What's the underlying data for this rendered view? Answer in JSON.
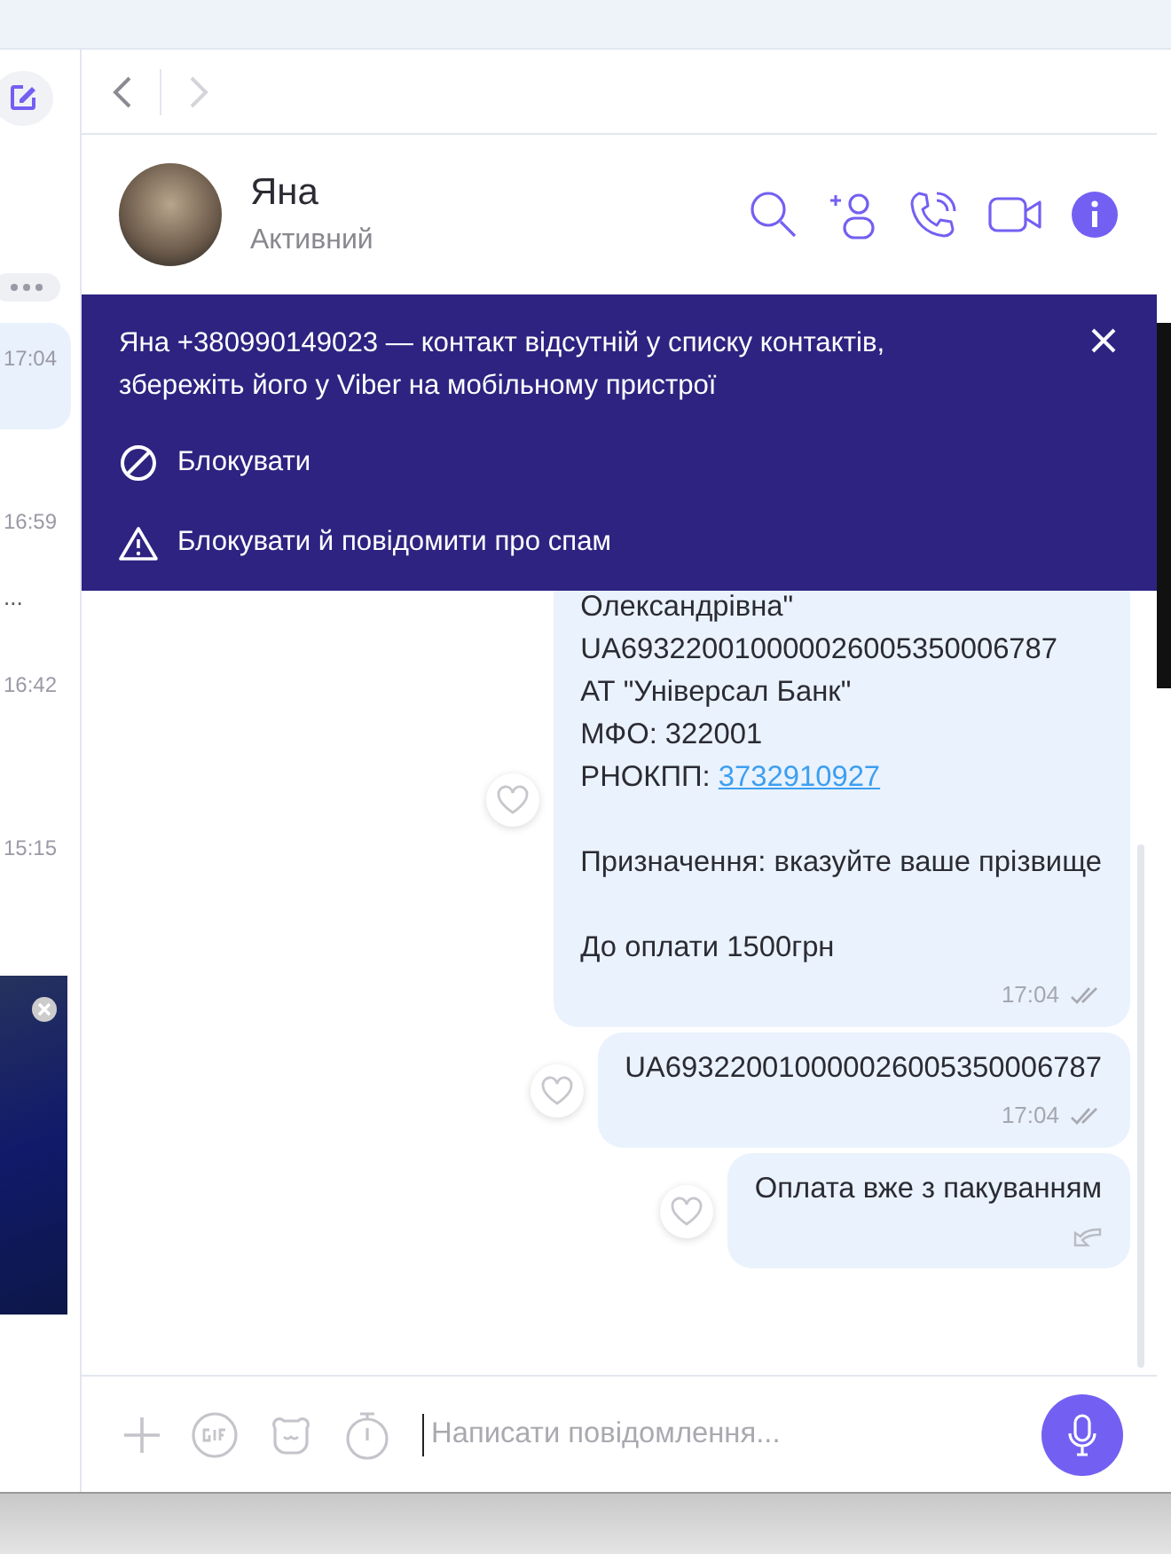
{
  "sidebar": {
    "chats": [
      {
        "time": "17:04",
        "selected": true
      },
      {
        "time": "16:59",
        "preview": "...",
        "selected": false
      },
      {
        "time": "16:42",
        "selected": false
      },
      {
        "time": "15:15",
        "selected": false
      }
    ]
  },
  "chat_header": {
    "name": "Яна",
    "status": "Активний"
  },
  "banner": {
    "text": "Яна +380990149023 — контакт відсутній у списку контактів, збережіть його у Viber на мобільному пристрої",
    "actions": [
      {
        "kind": "block",
        "label": "Блокувати"
      },
      {
        "kind": "spam",
        "label": "Блокувати й повідомити про спам"
      }
    ]
  },
  "messages": [
    {
      "blocks": [
        [
          {
            "kind": "text",
            "text": "Олександрівна\""
          },
          {
            "kind": "text",
            "text": "UA693220010000026005350006787"
          },
          {
            "kind": "text",
            "text": "АТ \"Універсал Банк\""
          },
          {
            "kind": "text",
            "text": "МФО: 322001"
          },
          {
            "kind": "link",
            "text": "РНОКПП: ",
            "link": "3732910927"
          }
        ],
        [
          {
            "kind": "text",
            "text": "Призначення: вказуйте ваше прізвище"
          }
        ],
        [
          {
            "kind": "text",
            "text": "До оплати 1500грн"
          }
        ]
      ],
      "time": "17:04",
      "kind": "delivered"
    },
    {
      "blocks": [
        [
          {
            "kind": "text",
            "text": "UA693220010000026005350006787"
          }
        ]
      ],
      "time": "17:04",
      "kind": "delivered"
    },
    {
      "blocks": [
        [
          {
            "kind": "text",
            "text": "Оплата вже з пакуванням"
          }
        ]
      ],
      "kind": "sending"
    }
  ],
  "composer": {
    "placeholder": "Написати повідомлення..."
  }
}
